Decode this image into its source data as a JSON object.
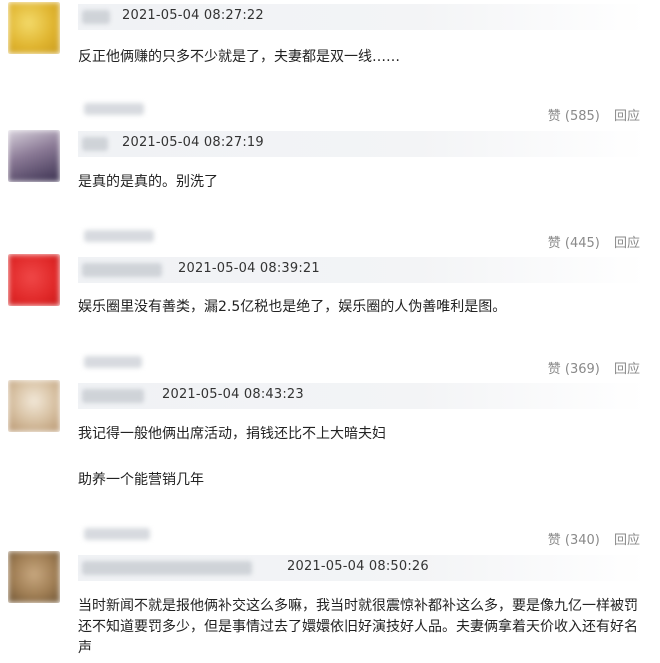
{
  "comments": [
    {
      "time": "2021-05-04 08:27:22",
      "text": "反正他俩赚的只多不少就是了，夫妻都是双一线……",
      "avatar_color": "#e8c94a",
      "likes": "赞 (585)",
      "reply": "回应"
    },
    {
      "time": "2021-05-04 08:27:19",
      "text": "是真的是真的。别洗了",
      "avatar_color": "#6a5a7a",
      "likes": "赞 (445)",
      "reply": "回应"
    },
    {
      "time": "2021-05-04 08:39:21",
      "text": "娱乐圈里没有善类，漏2.5亿税也是绝了，娱乐圈的人伪善唯利是图。",
      "avatar_color": "#e03030",
      "likes": "赞 (369)",
      "reply": "回应"
    },
    {
      "time": "2021-05-04 08:43:23",
      "text": "我记得一般他俩出席活动，捐钱还比不上大暗夫妇",
      "text2": "助养一个能营销几年",
      "avatar_color": "#d8c8b0",
      "likes": "赞 (340)",
      "reply": "回应"
    },
    {
      "time": "2021-05-04 08:50:26",
      "text": "当时新闻不就是报他俩补交这么多嘛，我当时就很震惊补都补这么多，要是像九亿一样被罚还不知道要罚多少，但是事情过去了嬛嬛依旧好演技好人品。夫妻俩拿着天价收入还有好名声",
      "avatar_color": "#a08058"
    }
  ]
}
